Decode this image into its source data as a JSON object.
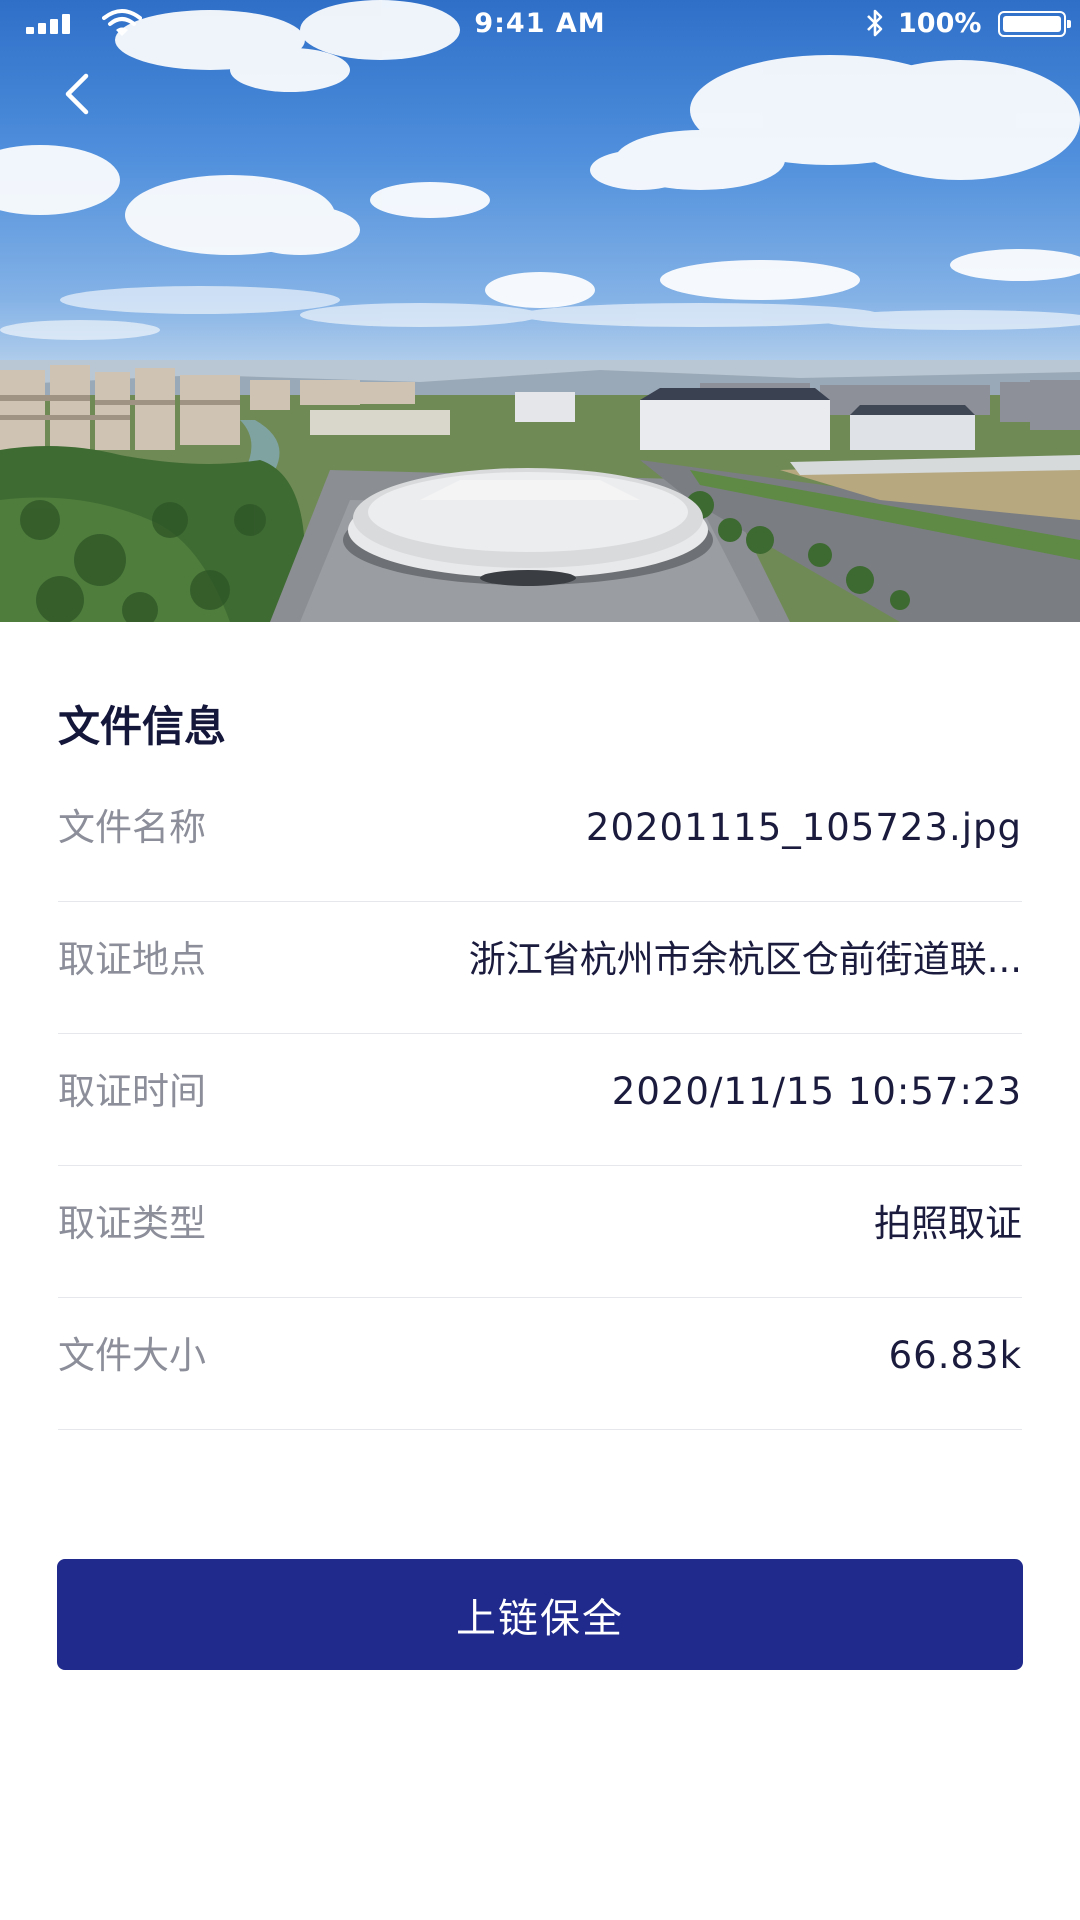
{
  "status_bar": {
    "time": "9:41 AM",
    "battery_percent": "100%",
    "icons": [
      "signal-icon",
      "wifi-icon",
      "bluetooth-icon",
      "battery-icon"
    ]
  },
  "header": {
    "back_icon": "chevron-left-icon"
  },
  "hero": {
    "image": "aerial city photo with stadium"
  },
  "file_info": {
    "title": "文件信息",
    "rows": [
      {
        "label": "文件名称",
        "value": "20201115_105723.jpg"
      },
      {
        "label": "取证地点",
        "value": "浙江省杭州市余杭区仓前街道联..."
      },
      {
        "label": "取证时间",
        "value": "2020/11/15 10:57:23"
      },
      {
        "label": "取证类型",
        "value": "拍照取证"
      },
      {
        "label": "文件大小",
        "value": "66.83k"
      }
    ]
  },
  "actions": {
    "primary_label": "上链保全"
  },
  "colors": {
    "primary": "#1f2a8c",
    "label_text": "#8c8e99",
    "value_text": "#1a1b3d",
    "divider": "#e6e7ec"
  }
}
